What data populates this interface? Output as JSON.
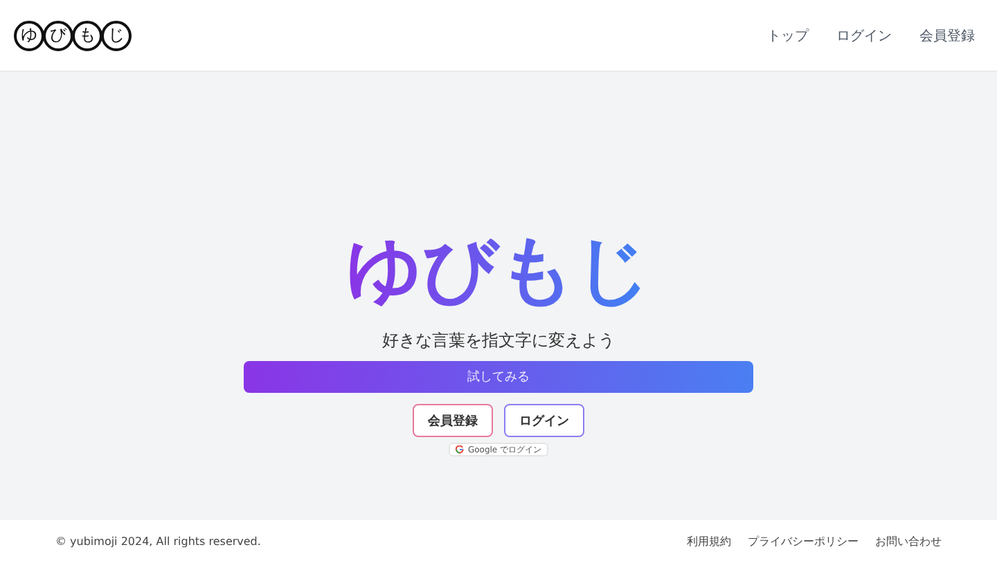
{
  "logo": [
    "ゆ",
    "び",
    "も",
    "じ"
  ],
  "nav": [
    "トップ",
    "ログイン",
    "会員登録"
  ],
  "hero": {
    "title": "ゆびもじ",
    "subtitle": "好きな言葉を指文字に変えよう",
    "try_button": "試してみる",
    "signup_button": "会員登録",
    "login_button": "ログイン",
    "google_button": "Google でログイン"
  },
  "footer": {
    "copyright": "© yubimoji 2024, All rights reserved.",
    "links": [
      "利用規約",
      "プライバシーポリシー",
      "お問い合わせ"
    ]
  }
}
